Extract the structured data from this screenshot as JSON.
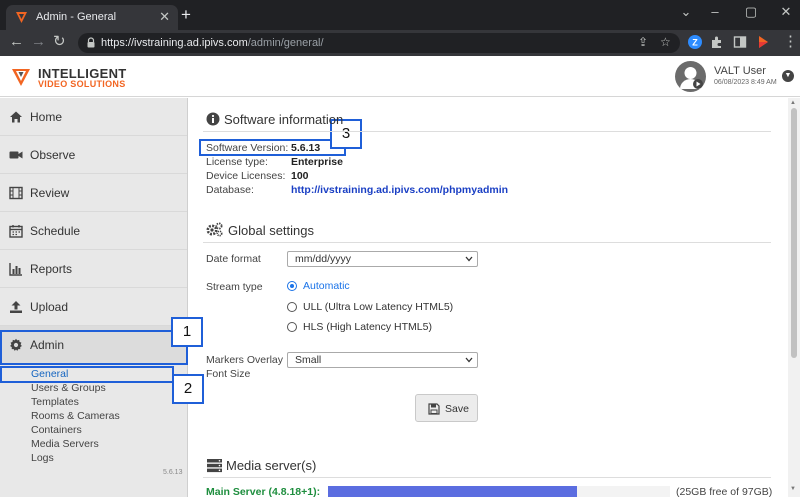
{
  "browser": {
    "tab_title": "Admin - General",
    "tab_close": "✕",
    "new_tab": "+",
    "url_host": "https://ivstraining.ad.ipivs.com",
    "url_path": "/admin/general/",
    "controls": {
      "minimize": "⌄",
      "min2": "–",
      "restore": "▢",
      "close": "✕"
    }
  },
  "header": {
    "brand_line1": "INTELLIGENT",
    "brand_line2": "VIDEO SOLUTIONS",
    "user_name": "VALT User",
    "user_date": "06/08/2023 8:49 AM"
  },
  "sidebar": {
    "items": [
      {
        "label": "Home",
        "icon": "home-icon"
      },
      {
        "label": "Observe",
        "icon": "video-camera-icon"
      },
      {
        "label": "Review",
        "icon": "film-icon"
      },
      {
        "label": "Schedule",
        "icon": "calendar-icon"
      },
      {
        "label": "Reports",
        "icon": "bar-chart-icon"
      },
      {
        "label": "Upload",
        "icon": "upload-icon"
      },
      {
        "label": "Admin",
        "icon": "gear-icon"
      }
    ],
    "sub_items": [
      "General",
      "Users & Groups",
      "Templates",
      "Rooms & Cameras",
      "Containers",
      "Media Servers",
      "Logs"
    ],
    "active_sub": "General",
    "version": "5.6.13"
  },
  "callouts": [
    "1",
    "2",
    "3"
  ],
  "software_info": {
    "title": "Software information",
    "version_label": "Software Version:",
    "version_value": "5.6.13",
    "license_label": "License type:",
    "license_value": "Enterprise",
    "devices_label": "Device Licenses:",
    "devices_value": "100",
    "database_label": "Database:",
    "database_value": "http://ivstraining.ad.ipivs.com/phpmyadmin"
  },
  "global_settings": {
    "title": "Global settings",
    "date_format_label": "Date format",
    "date_format_value": "mm/dd/yyyy",
    "stream_type_label": "Stream type",
    "stream_options": [
      "Automatic",
      "ULL (Ultra Low Latency HTML5)",
      "HLS (High Latency HTML5)"
    ],
    "stream_selected": "Automatic",
    "markers_label_1": "Markers Overlay",
    "markers_label_2": "Font Size",
    "markers_value": "Small",
    "save_label": "Save"
  },
  "media_servers": {
    "title": "Media server(s)",
    "server_name": "Main Server (4.8.18+1):",
    "usage_fraction": 0.727,
    "free_text": "(25GB  free of  97GB)"
  },
  "colors": {
    "accent_blue": "#1a73e8",
    "callout_blue": "#1f5fd8",
    "brand_orange": "#f26522",
    "server_green": "#1e8e3e",
    "usage_bar": "#5b6de0"
  }
}
